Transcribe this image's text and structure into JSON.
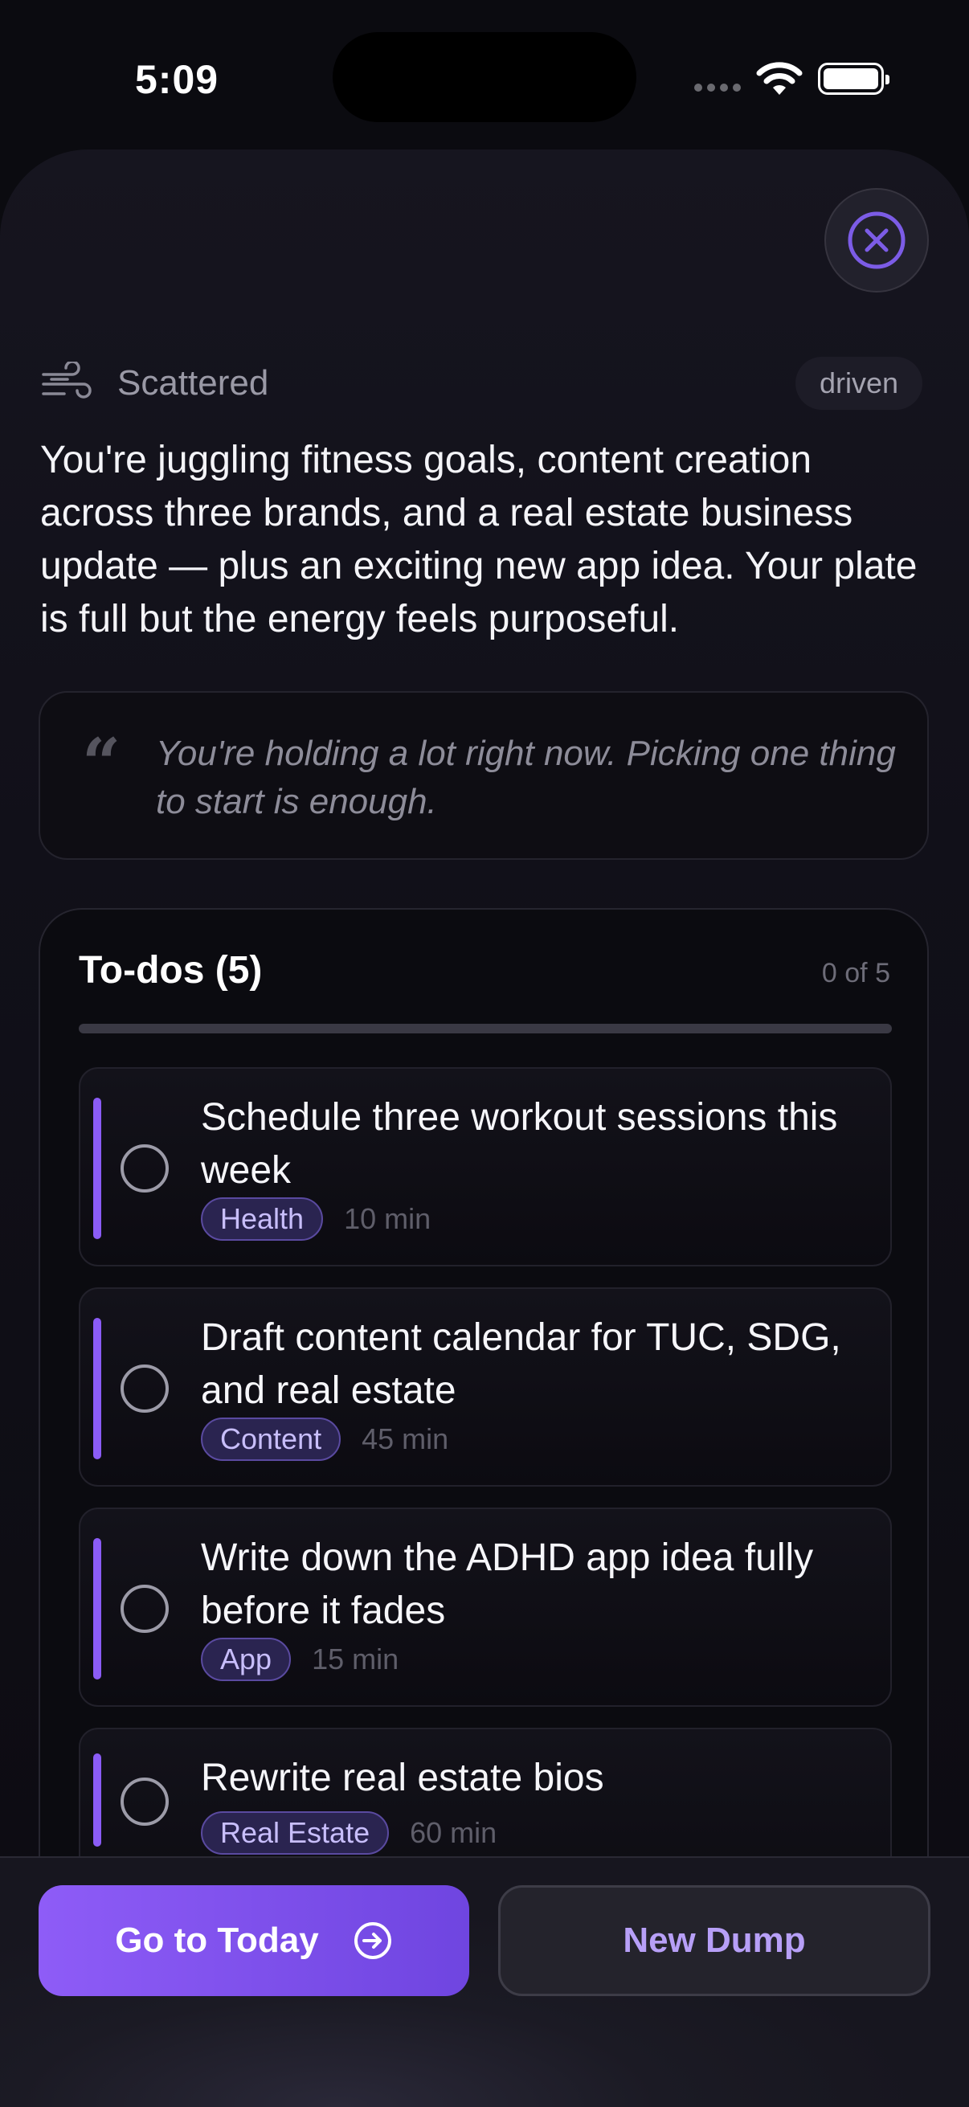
{
  "status_bar": {
    "time": "5:09"
  },
  "sheet": {
    "mood": {
      "label": "Scattered",
      "icon": "wind-icon"
    },
    "tag": "driven",
    "summary": "You're juggling fitness goals, content creation across three brands, and a real estate business update — plus an exciting new app idea. Your plate is full but the energy feels purposeful.",
    "quote": "You're holding a lot right now. Picking one thing to start is enough."
  },
  "todos": {
    "title": "To-dos (5)",
    "count_label": "0 of 5",
    "progress": 0,
    "accent_color": "#8b5cf6",
    "items": [
      {
        "title": "Schedule three workout sessions this week",
        "category": "Health",
        "duration": "10 min"
      },
      {
        "title": "Draft content calendar for TUC, SDG, and real estate",
        "category": "Content",
        "duration": "45 min"
      },
      {
        "title": "Write down the ADHD app idea fully before it fades",
        "category": "App",
        "duration": "15 min"
      },
      {
        "title": "Rewrite real estate bios",
        "category": "Real Estate",
        "duration": "60 min"
      }
    ]
  },
  "actions": {
    "primary_label": "Go to Today",
    "secondary_label": "New Dump"
  }
}
